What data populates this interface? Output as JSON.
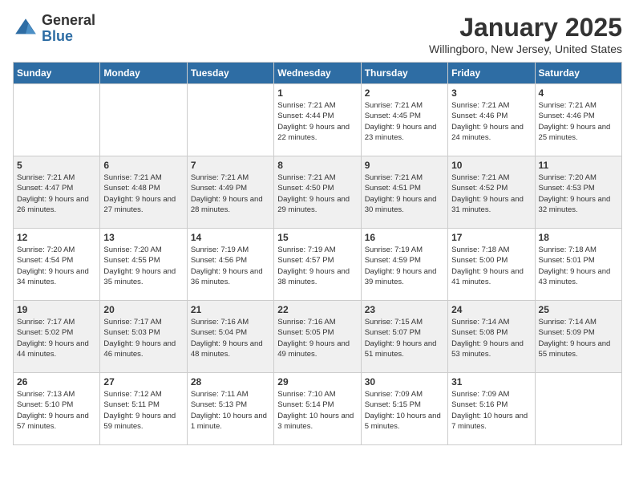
{
  "header": {
    "logo_general": "General",
    "logo_blue": "Blue",
    "month_title": "January 2025",
    "location": "Willingboro, New Jersey, United States"
  },
  "days_of_week": [
    "Sunday",
    "Monday",
    "Tuesday",
    "Wednesday",
    "Thursday",
    "Friday",
    "Saturday"
  ],
  "weeks": [
    [
      {
        "day": "",
        "info": ""
      },
      {
        "day": "",
        "info": ""
      },
      {
        "day": "",
        "info": ""
      },
      {
        "day": "1",
        "info": "Sunrise: 7:21 AM\nSunset: 4:44 PM\nDaylight: 9 hours and 22 minutes."
      },
      {
        "day": "2",
        "info": "Sunrise: 7:21 AM\nSunset: 4:45 PM\nDaylight: 9 hours and 23 minutes."
      },
      {
        "day": "3",
        "info": "Sunrise: 7:21 AM\nSunset: 4:46 PM\nDaylight: 9 hours and 24 minutes."
      },
      {
        "day": "4",
        "info": "Sunrise: 7:21 AM\nSunset: 4:46 PM\nDaylight: 9 hours and 25 minutes."
      }
    ],
    [
      {
        "day": "5",
        "info": "Sunrise: 7:21 AM\nSunset: 4:47 PM\nDaylight: 9 hours and 26 minutes."
      },
      {
        "day": "6",
        "info": "Sunrise: 7:21 AM\nSunset: 4:48 PM\nDaylight: 9 hours and 27 minutes."
      },
      {
        "day": "7",
        "info": "Sunrise: 7:21 AM\nSunset: 4:49 PM\nDaylight: 9 hours and 28 minutes."
      },
      {
        "day": "8",
        "info": "Sunrise: 7:21 AM\nSunset: 4:50 PM\nDaylight: 9 hours and 29 minutes."
      },
      {
        "day": "9",
        "info": "Sunrise: 7:21 AM\nSunset: 4:51 PM\nDaylight: 9 hours and 30 minutes."
      },
      {
        "day": "10",
        "info": "Sunrise: 7:21 AM\nSunset: 4:52 PM\nDaylight: 9 hours and 31 minutes."
      },
      {
        "day": "11",
        "info": "Sunrise: 7:20 AM\nSunset: 4:53 PM\nDaylight: 9 hours and 32 minutes."
      }
    ],
    [
      {
        "day": "12",
        "info": "Sunrise: 7:20 AM\nSunset: 4:54 PM\nDaylight: 9 hours and 34 minutes."
      },
      {
        "day": "13",
        "info": "Sunrise: 7:20 AM\nSunset: 4:55 PM\nDaylight: 9 hours and 35 minutes."
      },
      {
        "day": "14",
        "info": "Sunrise: 7:19 AM\nSunset: 4:56 PM\nDaylight: 9 hours and 36 minutes."
      },
      {
        "day": "15",
        "info": "Sunrise: 7:19 AM\nSunset: 4:57 PM\nDaylight: 9 hours and 38 minutes."
      },
      {
        "day": "16",
        "info": "Sunrise: 7:19 AM\nSunset: 4:59 PM\nDaylight: 9 hours and 39 minutes."
      },
      {
        "day": "17",
        "info": "Sunrise: 7:18 AM\nSunset: 5:00 PM\nDaylight: 9 hours and 41 minutes."
      },
      {
        "day": "18",
        "info": "Sunrise: 7:18 AM\nSunset: 5:01 PM\nDaylight: 9 hours and 43 minutes."
      }
    ],
    [
      {
        "day": "19",
        "info": "Sunrise: 7:17 AM\nSunset: 5:02 PM\nDaylight: 9 hours and 44 minutes."
      },
      {
        "day": "20",
        "info": "Sunrise: 7:17 AM\nSunset: 5:03 PM\nDaylight: 9 hours and 46 minutes."
      },
      {
        "day": "21",
        "info": "Sunrise: 7:16 AM\nSunset: 5:04 PM\nDaylight: 9 hours and 48 minutes."
      },
      {
        "day": "22",
        "info": "Sunrise: 7:16 AM\nSunset: 5:05 PM\nDaylight: 9 hours and 49 minutes."
      },
      {
        "day": "23",
        "info": "Sunrise: 7:15 AM\nSunset: 5:07 PM\nDaylight: 9 hours and 51 minutes."
      },
      {
        "day": "24",
        "info": "Sunrise: 7:14 AM\nSunset: 5:08 PM\nDaylight: 9 hours and 53 minutes."
      },
      {
        "day": "25",
        "info": "Sunrise: 7:14 AM\nSunset: 5:09 PM\nDaylight: 9 hours and 55 minutes."
      }
    ],
    [
      {
        "day": "26",
        "info": "Sunrise: 7:13 AM\nSunset: 5:10 PM\nDaylight: 9 hours and 57 minutes."
      },
      {
        "day": "27",
        "info": "Sunrise: 7:12 AM\nSunset: 5:11 PM\nDaylight: 9 hours and 59 minutes."
      },
      {
        "day": "28",
        "info": "Sunrise: 7:11 AM\nSunset: 5:13 PM\nDaylight: 10 hours and 1 minute."
      },
      {
        "day": "29",
        "info": "Sunrise: 7:10 AM\nSunset: 5:14 PM\nDaylight: 10 hours and 3 minutes."
      },
      {
        "day": "30",
        "info": "Sunrise: 7:09 AM\nSunset: 5:15 PM\nDaylight: 10 hours and 5 minutes."
      },
      {
        "day": "31",
        "info": "Sunrise: 7:09 AM\nSunset: 5:16 PM\nDaylight: 10 hours and 7 minutes."
      },
      {
        "day": "",
        "info": ""
      }
    ]
  ]
}
